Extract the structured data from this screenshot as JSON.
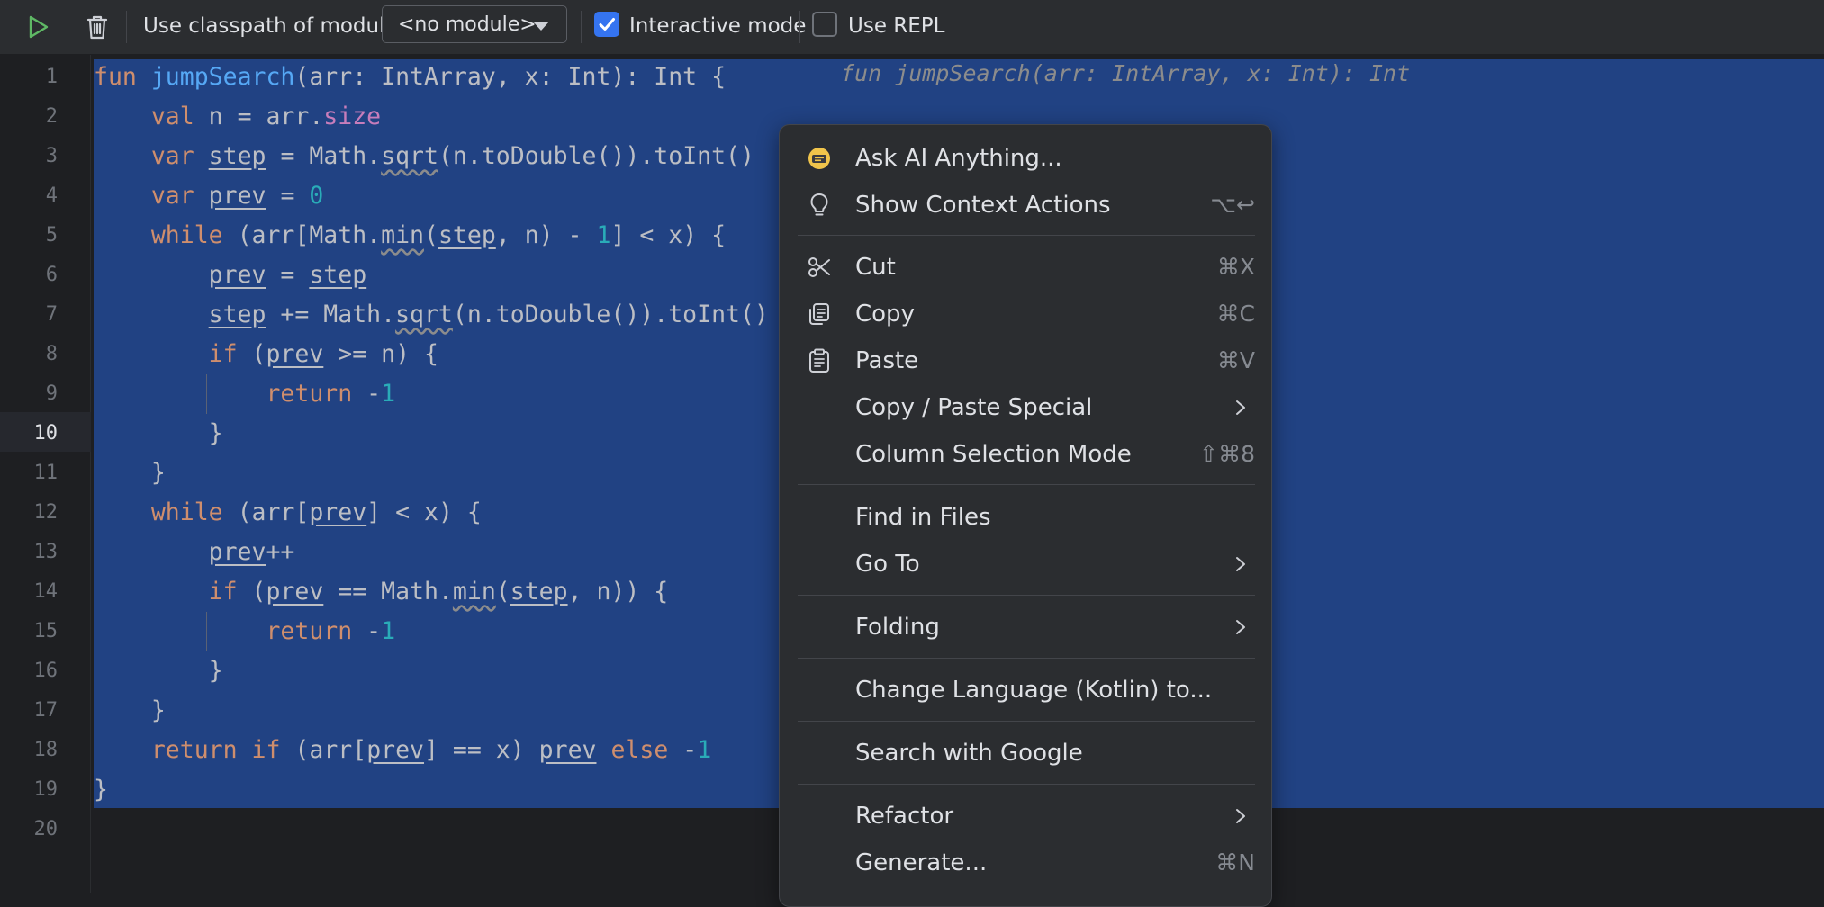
{
  "toolbar": {
    "classpath_label": "Use classpath of module",
    "module_value": "<no module>",
    "interactive_label": "Interactive mode",
    "interactive_checked": true,
    "repl_label": "Use REPL",
    "repl_checked": false
  },
  "editor": {
    "line_numbers": [
      "1",
      "2",
      "3",
      "4",
      "5",
      "6",
      "7",
      "8",
      "9",
      "10",
      "11",
      "12",
      "13",
      "14",
      "15",
      "16",
      "17",
      "18",
      "19",
      "20"
    ],
    "current_line": "10",
    "inline_hint": "fun jumpSearch(arr: IntArray, x: Int): Int",
    "code": {
      "l1_kw": "fun",
      "l1_fn": "jumpSearch",
      "l1_rest": "(arr: IntArray, x: Int): Int {",
      "l2_kw": "val",
      "l2_a": " n = arr.",
      "l2_prop": "size",
      "l3_kw": "var",
      "l3_var": "step",
      "l3_a": " = Math.",
      "l3_fn": "sqrt",
      "l3_b": "(n.toDouble()).toInt()",
      "l4_kw": "var",
      "l4_var": "prev",
      "l4_a": " = ",
      "l4_num": "0",
      "l5_kw": "while",
      "l5_a": " (arr[Math.",
      "l5_fn": "min",
      "l5_b": "(",
      "l5_var": "step",
      "l5_c": ", n) - ",
      "l5_num": "1",
      "l5_d": "] < x) {",
      "l6_var1": "prev",
      "l6_a": " = ",
      "l6_var2": "step",
      "l7_var": "step",
      "l7_a": " += Math.",
      "l7_fn": "sqrt",
      "l7_b": "(n.toDouble()).toInt()",
      "l8_kw": "if",
      "l8_a": " (",
      "l8_var": "prev",
      "l8_b": " >= n) {",
      "l9_kw": "return",
      "l9_a": " -",
      "l9_num": "1",
      "l10": "}",
      "l11": "}",
      "l12_kw": "while",
      "l12_a": " (arr[",
      "l12_var": "prev",
      "l12_b": "] < x) {",
      "l13_var": "prev",
      "l13_a": "++",
      "l14_kw": "if",
      "l14_a": " (",
      "l14_var1": "prev",
      "l14_b": " == Math.",
      "l14_fn": "min",
      "l14_c": "(",
      "l14_var2": "step",
      "l14_d": ", n)) {",
      "l15_kw": "return",
      "l15_a": " -",
      "l15_num": "1",
      "l16": "}",
      "l17": "}",
      "l18_kw1": "return",
      "l18_kw2": "if",
      "l18_a": " (arr[",
      "l18_var1": "prev",
      "l18_b": "] == x) ",
      "l18_var2": "prev",
      "l18_kw3": "else",
      "l18_c": " -",
      "l18_num": "1",
      "l19": "}"
    }
  },
  "menu": {
    "items": [
      {
        "label": "Ask AI Anything...",
        "shortcut": "",
        "icon": "ai-assistant-icon"
      },
      {
        "label": "Show Context Actions",
        "shortcut": "⌥↩",
        "icon": "lightbulb-icon"
      },
      {
        "label": "Cut",
        "shortcut": "⌘X",
        "icon": "scissors-icon"
      },
      {
        "label": "Copy",
        "shortcut": "⌘C",
        "icon": "copy-icon"
      },
      {
        "label": "Paste",
        "shortcut": "⌘V",
        "icon": "clipboard-icon"
      },
      {
        "label": "Copy / Paste Special",
        "shortcut": "",
        "icon": "chevron-right-icon"
      },
      {
        "label": "Column Selection Mode",
        "shortcut": "⇧⌘8",
        "icon": ""
      },
      {
        "label": "Find in Files",
        "shortcut": "",
        "icon": ""
      },
      {
        "label": "Go To",
        "shortcut": "",
        "icon": "chevron-right-icon"
      },
      {
        "label": "Folding",
        "shortcut": "",
        "icon": "chevron-right-icon"
      },
      {
        "label": "Change Language (Kotlin) to...",
        "shortcut": "",
        "icon": ""
      },
      {
        "label": "Search with Google",
        "shortcut": "",
        "icon": ""
      },
      {
        "label": "Refactor",
        "shortcut": "",
        "icon": "chevron-right-icon"
      },
      {
        "label": "Generate...",
        "shortcut": "⌘N",
        "icon": ""
      }
    ]
  },
  "colors": {
    "background": "#1e1f22",
    "toolbar": "#2b2d30",
    "selection": "#214283",
    "keyword": "#cf8e6d",
    "function": "#56a8f5",
    "number": "#2aacb8",
    "property": "#c77dbb",
    "accent": "#3574f0",
    "run_green": "#5fb865"
  }
}
